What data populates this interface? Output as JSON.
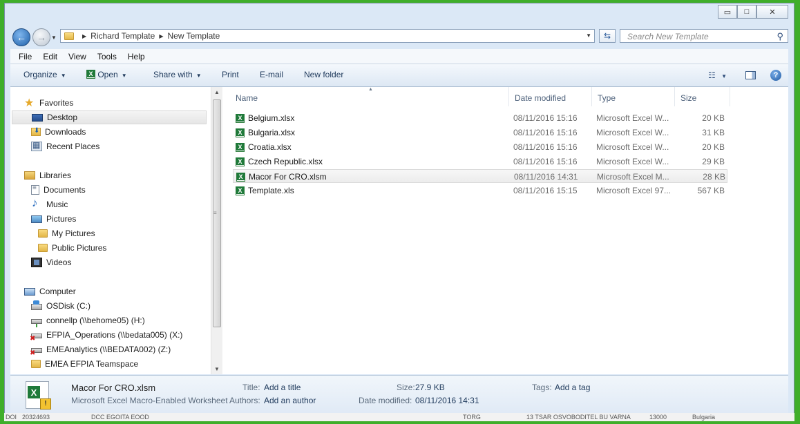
{
  "window": {
    "controls": {
      "minimize": "▭",
      "maximize": "□",
      "close": "✕"
    }
  },
  "address": {
    "crumbs": [
      "Richard Template",
      "New Template"
    ]
  },
  "search": {
    "placeholder": "Search New Template"
  },
  "menu": [
    "File",
    "Edit",
    "View",
    "Tools",
    "Help"
  ],
  "toolbar": {
    "organize": "Organize",
    "open": "Open",
    "share_with": "Share with",
    "print": "Print",
    "email": "E-mail",
    "new_folder": "New folder"
  },
  "nav": {
    "favorites": "Favorites",
    "desktop": "Desktop",
    "downloads": "Downloads",
    "recent_places": "Recent Places",
    "libraries": "Libraries",
    "documents": "Documents",
    "music": "Music",
    "pictures": "Pictures",
    "my_pictures": "My Pictures",
    "public_pictures": "Public Pictures",
    "videos": "Videos",
    "computer": "Computer",
    "osdisk": "OSDisk (C:)",
    "connellp": "connellp (\\\\behome05) (H:)",
    "efpia_ops": "EFPIA_Operations (\\\\bedata005) (X:)",
    "emeanalytics": "EMEAnalytics (\\\\BEDATA002) (Z:)",
    "emea_efpia": "EMEA EFPIA Teamspace"
  },
  "columns": {
    "name": "Name",
    "date": "Date modified",
    "type": "Type",
    "size": "Size"
  },
  "files": [
    {
      "name": "Belgium.xlsx",
      "date": "08/11/2016 15:16",
      "type": "Microsoft Excel W...",
      "size": "20 KB"
    },
    {
      "name": "Bulgaria.xlsx",
      "date": "08/11/2016 15:16",
      "type": "Microsoft Excel W...",
      "size": "31 KB"
    },
    {
      "name": "Croatia.xlsx",
      "date": "08/11/2016 15:16",
      "type": "Microsoft Excel W...",
      "size": "20 KB"
    },
    {
      "name": "Czech Republic.xlsx",
      "date": "08/11/2016 15:16",
      "type": "Microsoft Excel W...",
      "size": "29 KB"
    },
    {
      "name": "Macor For CRO.xlsm",
      "date": "08/11/2016 14:31",
      "type": "Microsoft Excel M...",
      "size": "28 KB"
    },
    {
      "name": "Template.xls",
      "date": "08/11/2016 15:15",
      "type": "Microsoft Excel 97...",
      "size": "567 KB"
    }
  ],
  "details": {
    "name": "Macor For CRO.xlsm",
    "kind": "Microsoft Excel Macro-Enabled Worksheet",
    "title_label": "Title:",
    "title_value": "Add a title",
    "authors_label": "Authors:",
    "authors_value": "Add an author",
    "size_label": "Size:",
    "size_value": "27.9 KB",
    "modified_label": "Date modified:",
    "modified_value": "08/11/2016 14:31",
    "tags_label": "Tags:",
    "tags_value": "Add a tag"
  },
  "background_strip": [
    "DOI",
    "20324693",
    "DCC EGOITA EOOD",
    "TORG",
    "13 TSAR OSVOBODITEL BU VARNA",
    "13000",
    "Bulgaria"
  ]
}
